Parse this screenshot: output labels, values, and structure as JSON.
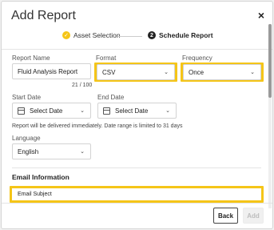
{
  "dialog": {
    "title": "Add Report",
    "close_glyph": "×"
  },
  "steps": [
    {
      "label": "Asset Selection",
      "glyph": "✓",
      "status": "complete"
    },
    {
      "label": "Schedule Report",
      "glyph": "2",
      "status": "current"
    }
  ],
  "form": {
    "report_name": {
      "label": "Report Name",
      "value": "Fluid Analysis Report",
      "counter": "21 / 100"
    },
    "format": {
      "label": "Format",
      "value": "CSV"
    },
    "frequency": {
      "label": "Frequency",
      "value": "Once"
    },
    "start_date": {
      "label": "Start Date",
      "value": "Select Date"
    },
    "end_date": {
      "label": "End Date",
      "value": "Select Date"
    },
    "hint": "Report will be delivered immediately. Date range is limited to 31 days",
    "language": {
      "label": "Language",
      "value": "English"
    }
  },
  "email": {
    "section_title": "Email Information",
    "subject_placeholder": "Email Subject"
  },
  "footer": {
    "back_label": "Back",
    "add_label": "Add"
  },
  "colors": {
    "highlight": "#f5c518",
    "accent": "#f5c518"
  }
}
